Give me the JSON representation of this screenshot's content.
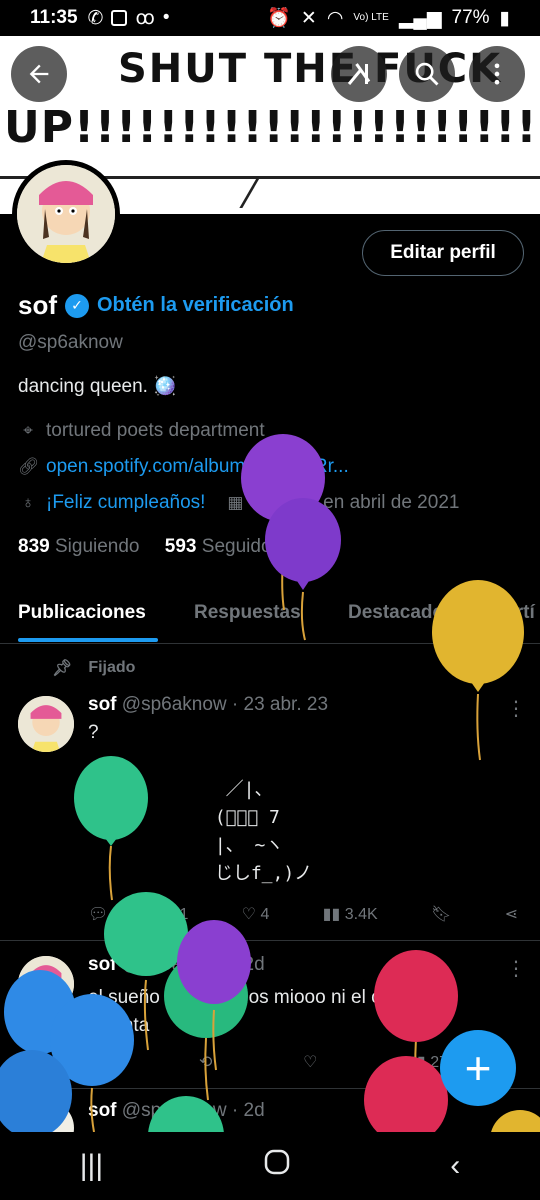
{
  "status_bar": {
    "time": "11:35",
    "battery": "77%",
    "network": "Vo) LTE"
  },
  "banner": {
    "line1": "SHUT THE FUCK",
    "line2": "UP!!!!!!!!!!!!!!!!!!!!!!!!!!!"
  },
  "profile": {
    "edit_label": "Editar perfil",
    "name": "sof",
    "verification_cta": "Obtén la verificación",
    "handle": "@sp6aknow",
    "bio": "dancing queen. 🪩",
    "location": "tortured poets department",
    "link": "open.spotify.com/album/6kZ42qRr...",
    "birthday": "¡Feliz cumpleaños!",
    "joined": "Se unió en abril de 2021",
    "following_count": "839",
    "following_label": "Siguiendo",
    "followers_count": "593",
    "followers_label": "Seguidores"
  },
  "tabs": [
    "Publicaciones",
    "Respuestas",
    "Destacados",
    "Artí"
  ],
  "pinned_label": "Fijado",
  "posts": [
    {
      "name": "sof",
      "handle": "@sp6aknow",
      "date": "· 23 abr. 23",
      "text": "?",
      "ascii": [
        "  ／|、",
        " (ﾟ､。 7",
        " |、 ~ヽ",
        " じしf_,)ノ"
      ],
      "stats": {
        "replies": "",
        "reposts": "1",
        "likes": "4",
        "views": "3.4K"
      }
    },
    {
      "name": "sof",
      "handle": "@sp6aknow",
      "date": "· 2d",
      "text": "el sueño q tengo dios miooo ni el café me levanta",
      "stats": {
        "views": "27"
      }
    },
    {
      "name": "sof",
      "handle": "@sp6aknow",
      "date": "· 2d"
    }
  ],
  "colors": {
    "accent": "#1d9bf0",
    "background": "#000000"
  }
}
